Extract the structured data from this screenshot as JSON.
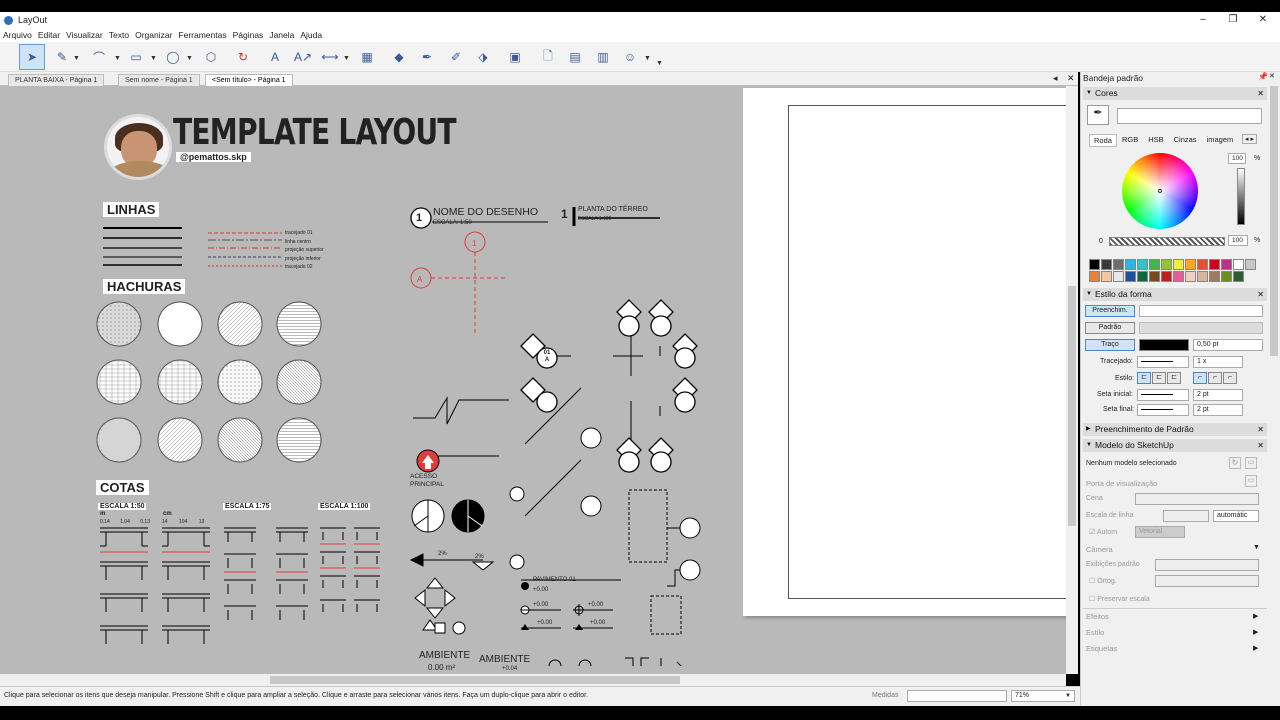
{
  "app": {
    "title": "LayOut"
  },
  "menu": [
    "Arquivo",
    "Editar",
    "Visualizar",
    "Texto",
    "Organizar",
    "Ferramentas",
    "Páginas",
    "Janela",
    "Ajuda"
  ],
  "tabs": [
    "PLANTA BAIXA - Página 1",
    "Sem nome - Página 1",
    "<Sem título> - Página 1"
  ],
  "document": {
    "title": "TEMPLATE LAYOUT",
    "handle": "@pemattos.skp",
    "sections": {
      "lines": "LINHAS",
      "hatches": "HACHURAS",
      "dims": "COTAS"
    },
    "line_labels": [
      "tracejado 01",
      "linha centro",
      "projeção superior",
      "projeção inferior",
      "tracejado 02"
    ],
    "drawing_title": "NOME DO DESENHO",
    "drawing_scale": "ESCALA: 1:50",
    "drawing_num": "1",
    "plan_title": "PLANTA DO TÉRREO",
    "plan_scale": "ESCALA 1:100",
    "access_label": "ACESSO\nPRINCIPAL",
    "slope": "2%",
    "pavement": "PAVIMENTO 01",
    "level": "+0.00",
    "level2": "+0.04",
    "ambiente": "AMBIENTE",
    "area": "0.00 m²",
    "section_mark": "A",
    "sheet_ref": "01",
    "scales": [
      "ESCALA 1:50",
      "ESCALA 1:75",
      "ESCALA 1:100"
    ],
    "units": [
      "m",
      "cm"
    ],
    "dim_values_m": [
      "0.14",
      "1.04",
      "0.13"
    ],
    "dim_values_cm": [
      "14",
      "104",
      "13"
    ]
  },
  "statusbar": {
    "hint": "Clique para selecionar os itens que deseja manipular. Pressione Shift e clique para ampliar a seleção. Clique e arraste para selecionar vários itens. Faça um duplo-clique para abrir o editor.",
    "measures_label": "Medidas",
    "zoom": "71%"
  },
  "tray": {
    "title": "Bandeja padrão",
    "colors": {
      "header": "Cores",
      "tabs": [
        "Roda",
        "RGB",
        "HSB",
        "Cinzas",
        "imagem"
      ],
      "brightness": "100",
      "opacity_min": "0",
      "opacity": "100",
      "percent": "%",
      "swatches": [
        "#000000",
        "#3a3a3a",
        "#6e6e6e",
        "#2fb4e8",
        "#36c0c9",
        "#3fb54b",
        "#8fc43a",
        "#f2ec3b",
        "#f5a623",
        "#e8502a",
        "#d0021b",
        "#b8338a",
        "#ffffff",
        "#c8c8c8",
        "#e8813a",
        "#f4c7a3",
        "#e8e8e8",
        "#1c4f9c",
        "#0b6b3a",
        "#7a4a1e",
        "#c41d1d",
        "#e85c9c",
        "#f0d0c0",
        "#d4b896",
        "#9c7c5c",
        "#6b8e23",
        "#2e5e2e"
      ]
    },
    "shape_style": {
      "header": "Estilo da forma",
      "fill": "Preenchim.",
      "pattern": "Padrão",
      "stroke": "Traço",
      "stroke_width": "0,50 pt",
      "dashed": "Tracejado:",
      "dash_scale": "1 x",
      "style": "Estilo:",
      "start_arrow": "Seta inicial:",
      "start_size": "2 pt",
      "end_arrow": "Seta final:",
      "end_size": "2 pt"
    },
    "pattern_fill": {
      "header": "Preenchimento de Padrão"
    },
    "sketchup_model": {
      "header": "Modelo do SketchUp",
      "none": "Nenhum modelo selecionado",
      "viewport": "Porta de visualização",
      "scene": "Cena",
      "line_scale": "Escala de linha",
      "auto_value": "automátic",
      "auto": "Autom.",
      "vector": "Vetorial",
      "camera": "Câmera",
      "default_views": "Exibições padrão",
      "ortho": "Ortog.",
      "preserve_scale": "Preservar escala",
      "effects": "Efeitos",
      "style": "Estilo",
      "tags": "Etiquetas"
    }
  },
  "colors": {
    "accent": "#cfe3f7",
    "canvas": "#b9b9b9",
    "red": "#e23b3b"
  }
}
